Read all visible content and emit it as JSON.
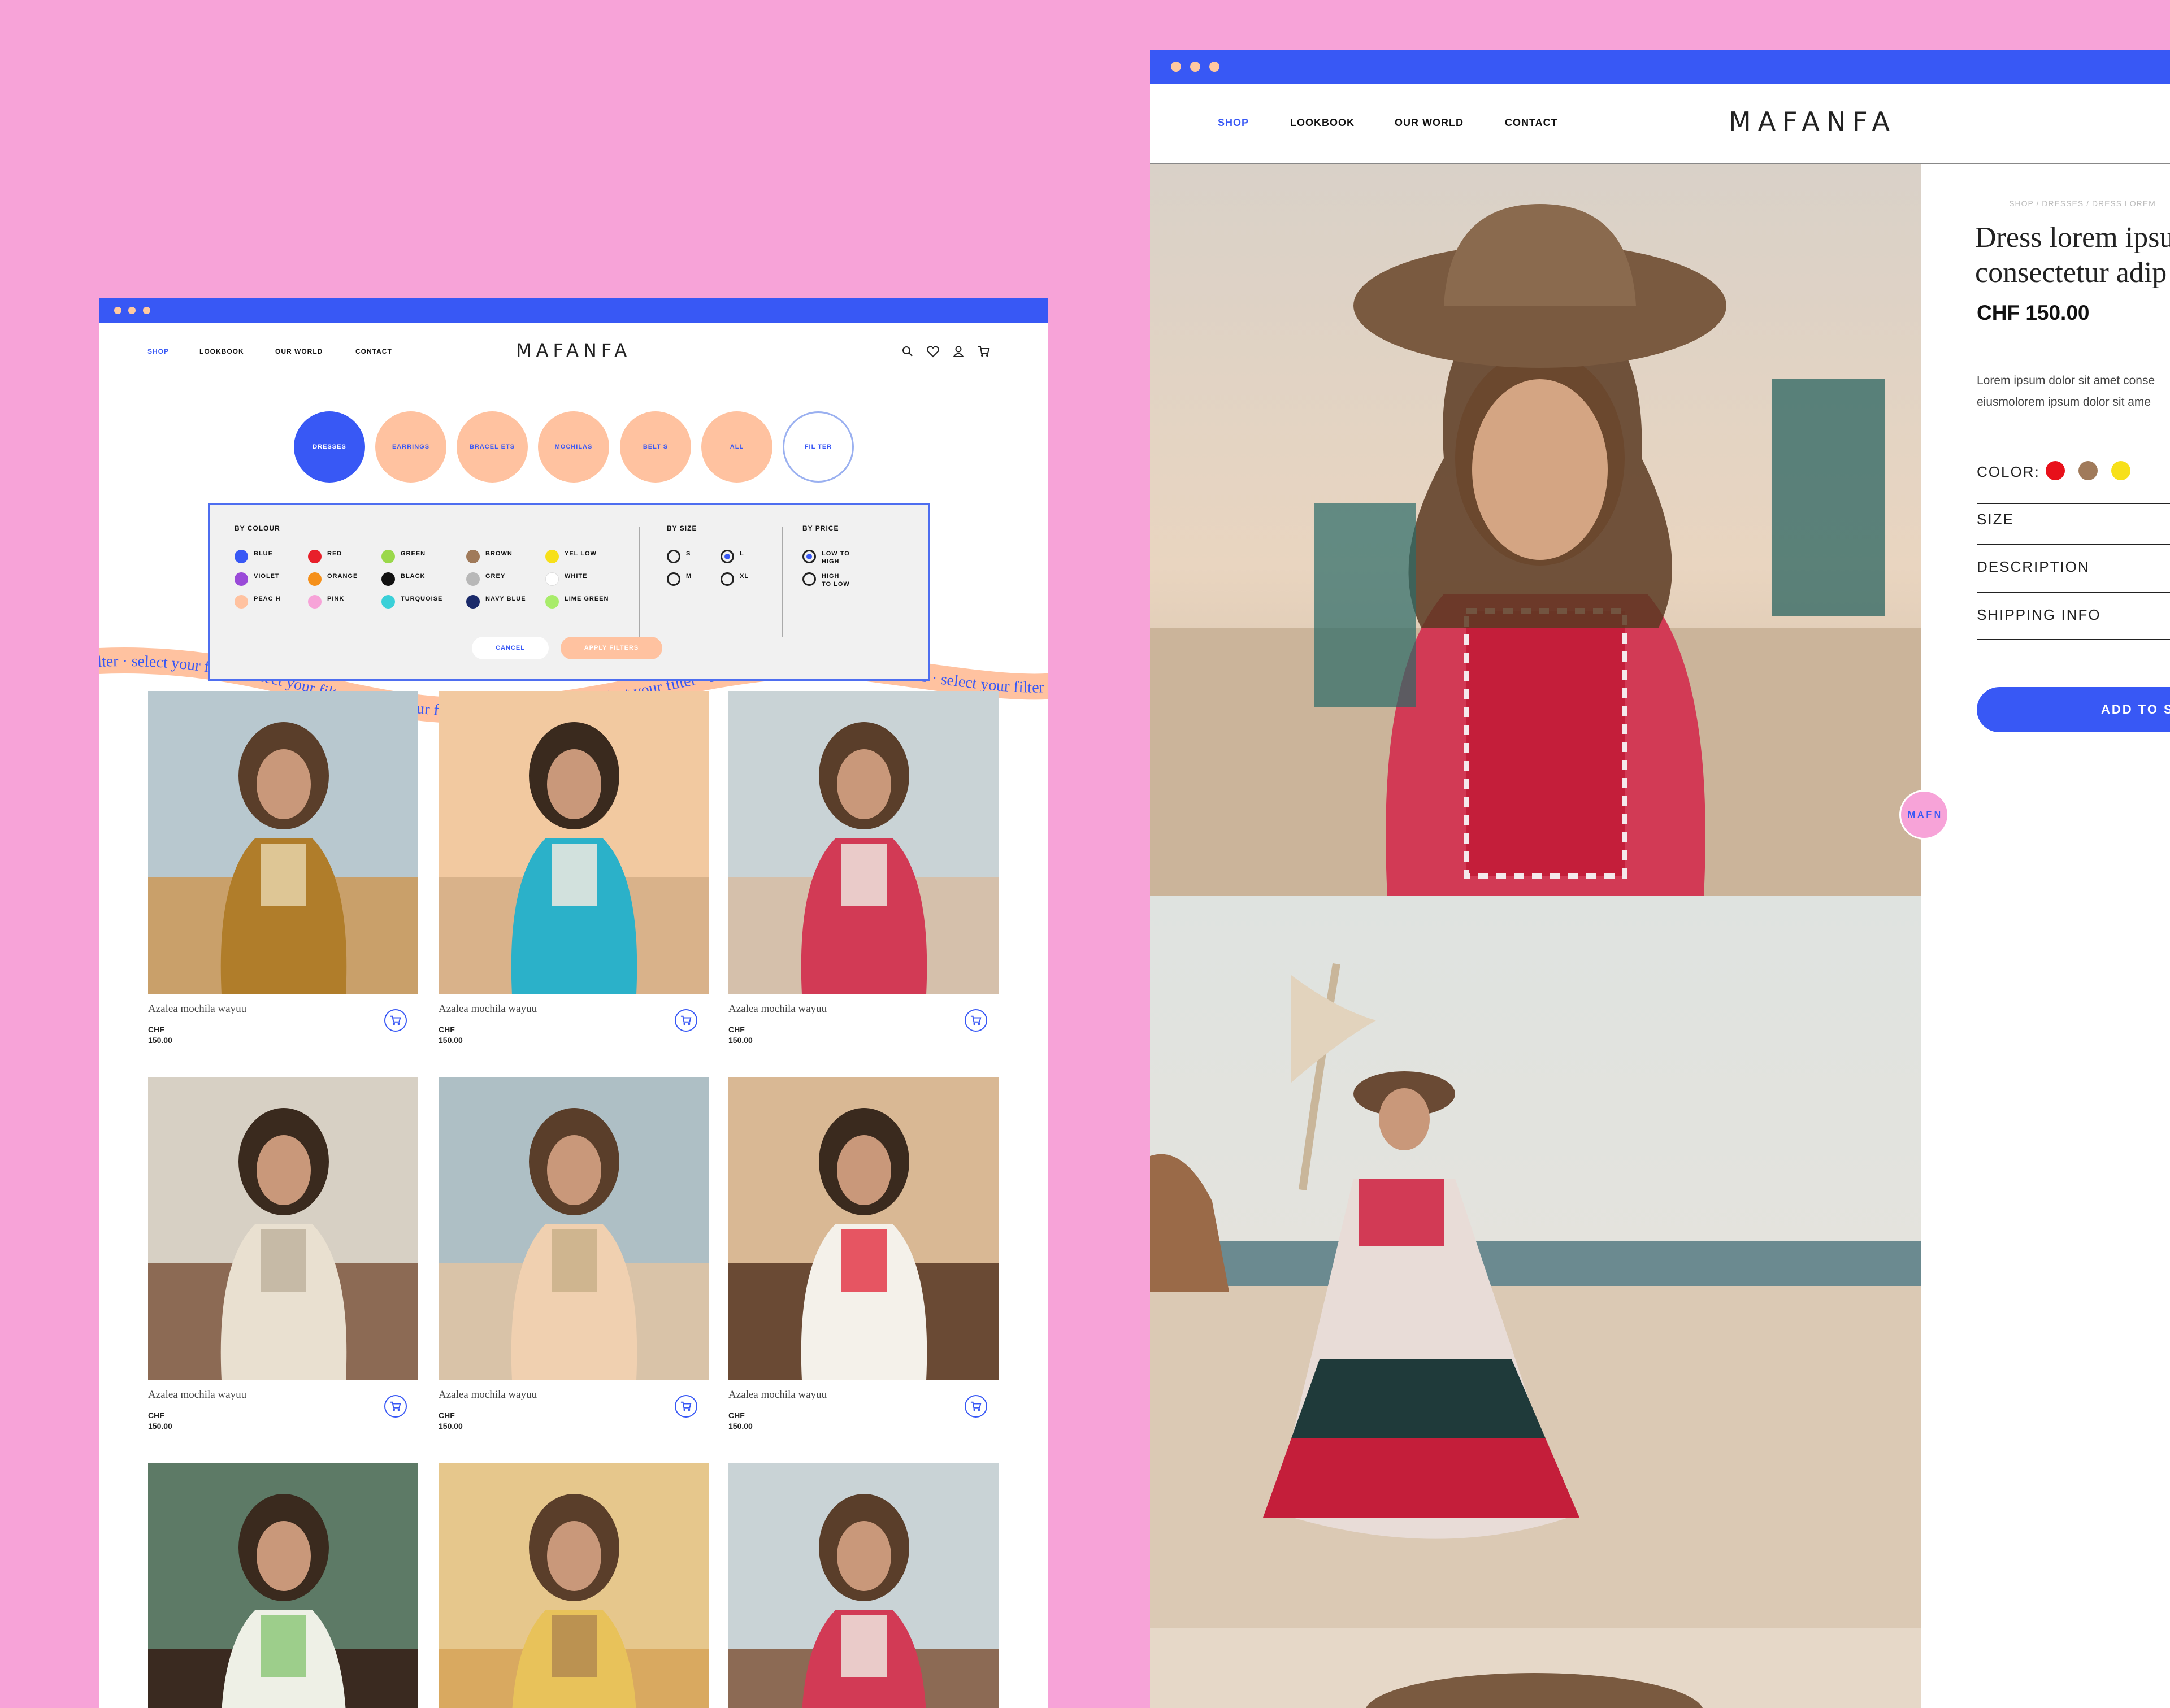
{
  "listing": {
    "nav": [
      "SHOP",
      "LOOKBOOK",
      "OUR WORLD",
      "CONTACT"
    ],
    "logo": "MAFANFA",
    "icons": [
      "search-icon",
      "heart-icon",
      "user-icon",
      "cart-icon"
    ],
    "categories": [
      "DRESSES",
      "EARRINGS",
      "BRACEL ETS",
      "MOCHILAS",
      "BELT S",
      "ALL",
      "FIL TER"
    ],
    "filter": {
      "colour_heading": "BY COLOUR",
      "size_heading": "BY SIZE",
      "price_heading": "BY PRICE",
      "colours": [
        {
          "label": "BLUE",
          "color": "#3858f5"
        },
        {
          "label": "VIOLET",
          "color": "#9a4ad8"
        },
        {
          "label": "PEAC H",
          "color": "#ffc2a0"
        },
        {
          "label": "RED",
          "color": "#e8202a"
        },
        {
          "label": "ORANGE",
          "color": "#f5901a"
        },
        {
          "label": "PINK",
          "color": "#f7a3d8"
        },
        {
          "label": "GREEN",
          "color": "#9ad84a"
        },
        {
          "label": "BLACK",
          "color": "#111111"
        },
        {
          "label": "TURQUOISE",
          "color": "#3ad0d8"
        },
        {
          "label": "BROWN",
          "color": "#a07a5a"
        },
        {
          "label": "GREY",
          "color": "#b8b8b8"
        },
        {
          "label": "NAVY BLUE",
          "color": "#1a2a6a"
        },
        {
          "label": "YEL LOW",
          "color": "#f7e01a"
        },
        {
          "label": "WHITE",
          "color": "#ffffff"
        },
        {
          "label": "LIME GREEN",
          "color": "#a8ec6a"
        }
      ],
      "sizes": [
        {
          "label": "S",
          "checked": false
        },
        {
          "label": "L",
          "checked": true
        },
        {
          "label": "M",
          "checked": false
        },
        {
          "label": "XL",
          "checked": false
        }
      ],
      "prices": [
        {
          "label": "LOW TO HIGH",
          "checked": true
        },
        {
          "label": "HIGH TO LOW",
          "checked": false
        }
      ],
      "cancel": "CANCEL",
      "apply": "APPLY FILTERS"
    },
    "ribbon_text": "filter · select your filter · select your filter · select your filter · select your filter · select your filter · select your filter · select your filter · select your filter · select your filter · select your filter · select you",
    "products": [
      {
        "name": "Azalea mochila wayuu",
        "currency": "CHF",
        "price": "150.00"
      },
      {
        "name": "Azalea mochila wayuu",
        "currency": "CHF",
        "price": "150.00"
      },
      {
        "name": "Azalea mochila wayuu",
        "currency": "CHF",
        "price": "150.00"
      },
      {
        "name": "Azalea mochila wayuu",
        "currency": "CHF",
        "price": "150.00"
      },
      {
        "name": "Azalea mochila wayuu",
        "currency": "CHF",
        "price": "150.00"
      },
      {
        "name": "Azalea mochila wayuu",
        "currency": "CHF",
        "price": "150.00"
      }
    ]
  },
  "detail": {
    "nav": [
      "SHOP",
      "LOOKBOOK",
      "OUR WORLD",
      "CONTACT"
    ],
    "logo": "MAFANFA",
    "breadcrumb": "SHOP / DRESSES / DRESS LOREM",
    "title_line1": "Dress lorem ipsu",
    "title_line2": "consectetur adip",
    "price": "CHF 150.00",
    "desc_line1": "Lorem ipsum dolor sit amet conse",
    "desc_line2": "eiusmolorem ipsum dolor sit ame",
    "color_label": "COLOR:",
    "colors": [
      "#e8101a",
      "#a07a5a",
      "#f7e01a"
    ],
    "accordion": [
      "SIZE",
      "DESCRIPTION",
      "SHIPPING INFO"
    ],
    "add_to_cart": "ADD TO S",
    "badge": "M A F N"
  }
}
